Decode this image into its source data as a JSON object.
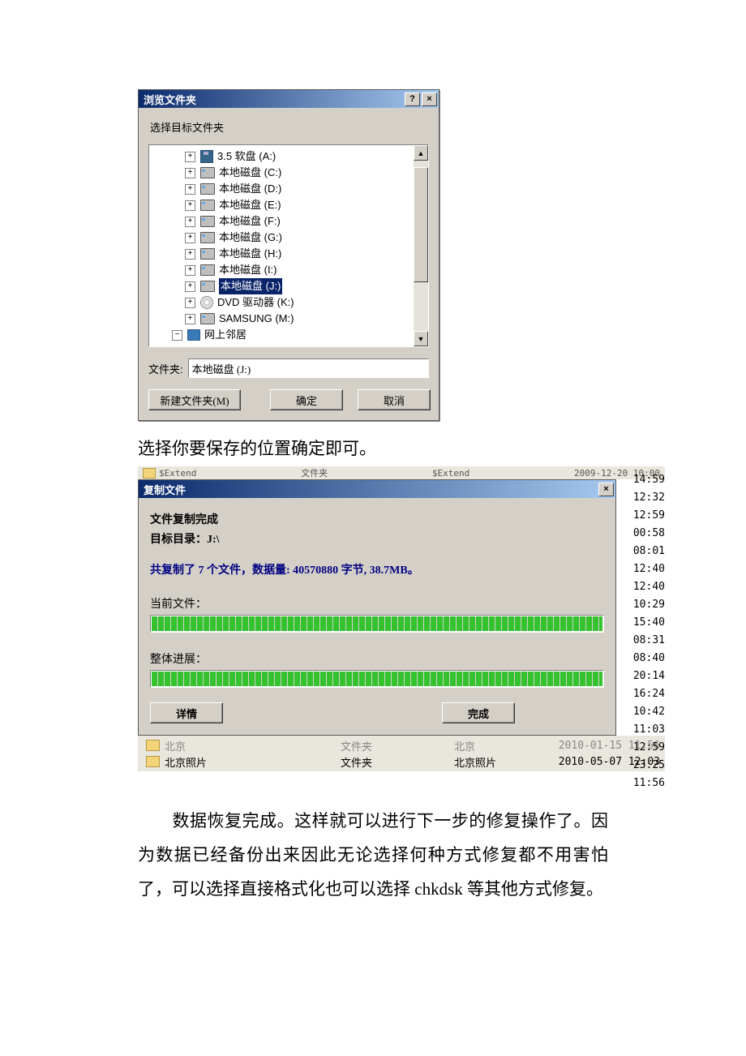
{
  "browse_dialog": {
    "title": "浏览文件夹",
    "help_btn": "?",
    "close_btn": "×",
    "prompt": "选择目标文件夹",
    "scroll_up": "▲",
    "scroll_down": "▼",
    "tree": [
      {
        "exp": "+",
        "type": "floppy",
        "label": "3.5 软盘 (A:)"
      },
      {
        "exp": "+",
        "type": "drive",
        "label": "本地磁盘 (C:)"
      },
      {
        "exp": "+",
        "type": "drive",
        "label": "本地磁盘 (D:)"
      },
      {
        "exp": "+",
        "type": "drive",
        "label": "本地磁盘 (E:)"
      },
      {
        "exp": "+",
        "type": "drive",
        "label": "本地磁盘 (F:)"
      },
      {
        "exp": "+",
        "type": "drive",
        "label": "本地磁盘 (G:)"
      },
      {
        "exp": "+",
        "type": "drive",
        "label": "本地磁盘 (H:)"
      },
      {
        "exp": "+",
        "type": "drive",
        "label": "本地磁盘 (I:)"
      },
      {
        "exp": "+",
        "type": "drive",
        "label": "本地磁盘 (J:)",
        "selected": true
      },
      {
        "exp": "+",
        "type": "dvd",
        "label": "DVD 驱动器 (K:)"
      },
      {
        "exp": "+",
        "type": "drive",
        "label": "SAMSUNG (M:)"
      },
      {
        "exp": "−",
        "type": "net",
        "label": "网上邻居",
        "last": true
      }
    ],
    "folder_label": "文件夹:",
    "folder_value": "本地磁盘 (J:)",
    "btn_new": "新建文件夹(M)",
    "btn_ok": "确定",
    "btn_cancel": "取消"
  },
  "caption1": "选择你要保存的位置确定即可。",
  "bg_header": {
    "left": "$Extend",
    "mid1": "文件夹",
    "mid2": "$Extend",
    "right": "2009-12-20 10:00"
  },
  "copy_dialog": {
    "title": "复制文件",
    "close_btn": "×",
    "line1": "文件复制完成",
    "line2": "目标目录：J:\\",
    "line3": "共复制了 7 个文件，数据量: 40570880 字节, 38.7MB。",
    "current_label": "当前文件：",
    "overall_label": "整体进展：",
    "btn_details": "详情",
    "btn_done": "完成"
  },
  "side_times": [
    "14:59",
    "12:32",
    "12:59",
    "00:58",
    "08:01",
    "12:40",
    "12:40",
    "10:29",
    "15:40",
    "08:31",
    "08:40",
    "20:14",
    "16:24",
    "10:42",
    "11:03",
    "12:59",
    "23:25",
    "11:56"
  ],
  "bg_rows": [
    {
      "name": "北京",
      "type": "文件夹",
      "name2": "北京",
      "date": "2010-01-15 11:56",
      "dim": true
    },
    {
      "name": "北京照片",
      "type": "文件夹",
      "name2": "北京照片",
      "date": "2010-05-07 12:03",
      "dim": false
    }
  ],
  "paragraph": "数据恢复完成。这样就可以进行下一步的修复操作了。因为数据已经备份出来因此无论选择何种方式修复都不用害怕了，可以选择直接格式化也可以选择 chkdsk 等其他方式修复。"
}
